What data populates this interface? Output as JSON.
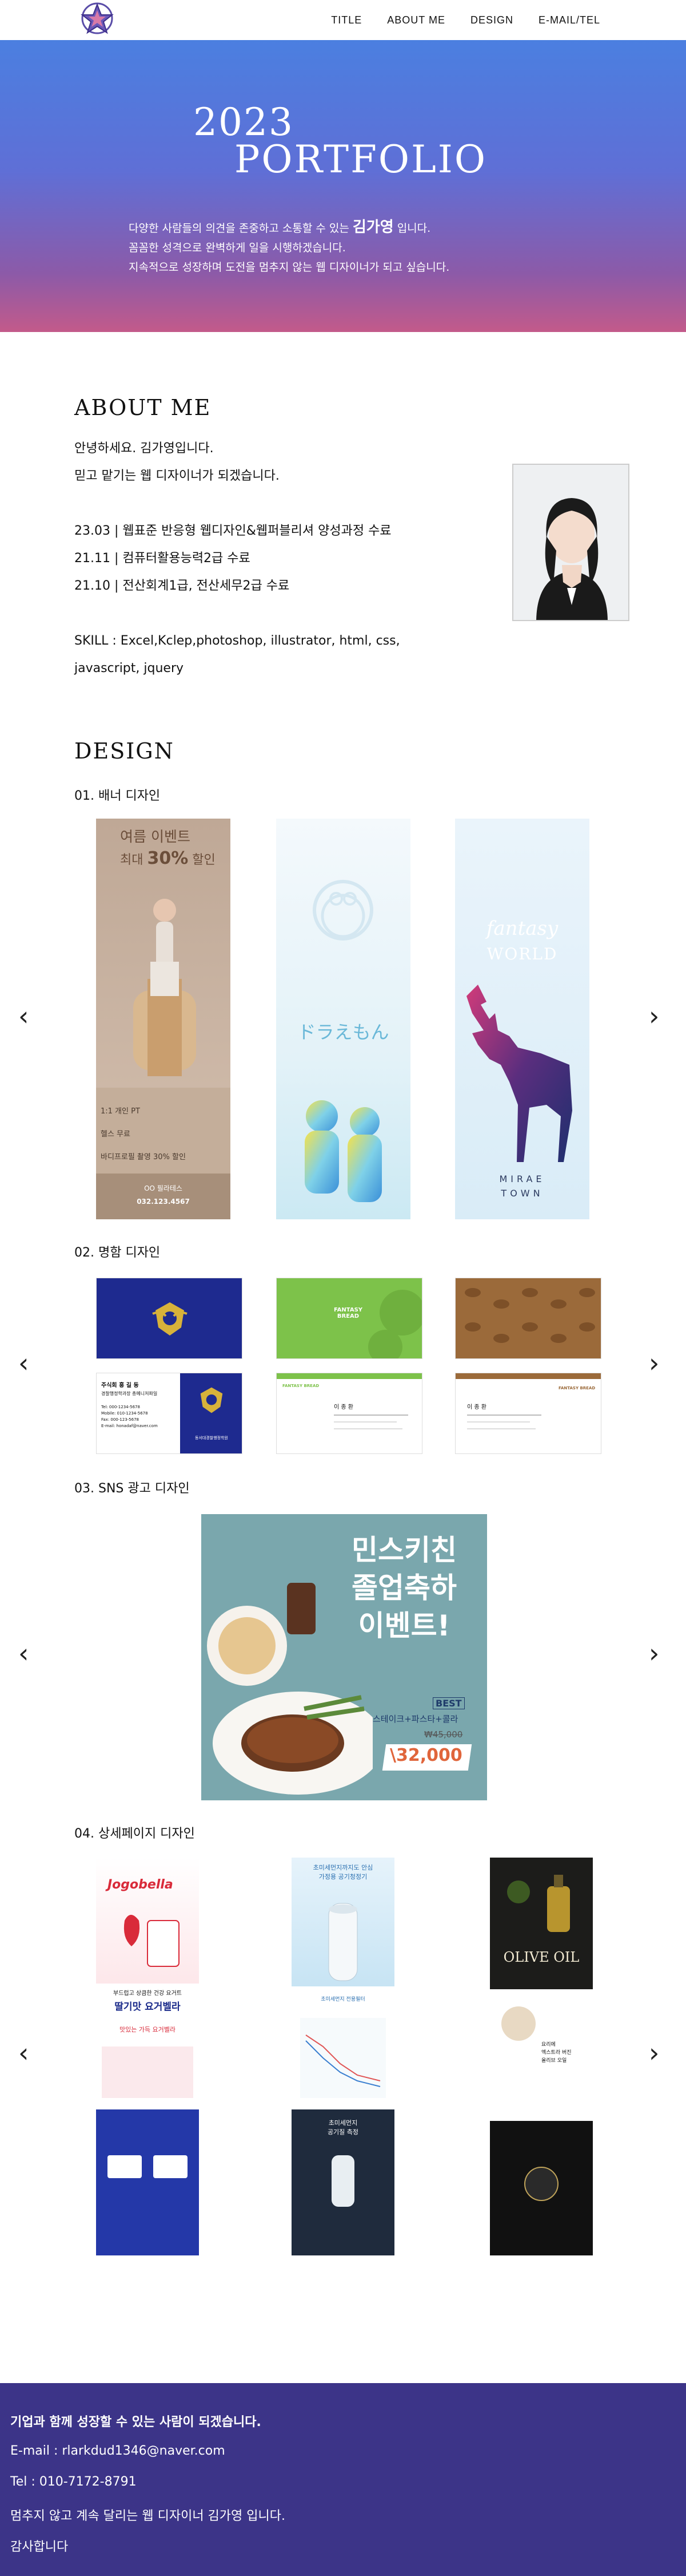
{
  "nav": {
    "links": [
      "TITLE",
      "ABOUT ME",
      "DESIGN",
      "E-MAIL/TEL"
    ]
  },
  "hero": {
    "year": "2023",
    "title": "PORTFOLIO",
    "line1_pre": "다양한 사람들의 의견을 존중하고 소통할 수 있는",
    "line1_name": "김가영",
    "line1_post": "입니다.",
    "line2": "꼼꼼한 성격으로 완벽하게 일을 시행하겠습니다.",
    "line3": "지속적으로 성장하며 도전을 멈추지 않는 웹 디자이너가 되고 싶습니다."
  },
  "about": {
    "heading": "ABOUT ME",
    "greeting1": "안녕하세요. 김가영입니다.",
    "greeting2": "믿고 맡기는 웹 디자이너가 되겠습니다.",
    "history": [
      "23.03 | 웹표준 반응형 웹디자인&웹퍼블리셔 양성과정 수료",
      "21.11 | 컴퓨터활용능력2급 수료",
      "21.10 | 전산회계1급, 전산세무2급 수료"
    ],
    "skill1": "SKILL : Excel,Kclep,photoshop, illustrator, html, css,",
    "skill2": "javascript, jquery"
  },
  "design": {
    "heading": "DESIGN",
    "sections": [
      "01. 배너 디자인",
      "02. 명함 디자인",
      "03. SNS 광고 디자인",
      "04. 상세페이지 디자인"
    ],
    "arrow_prev": "‹",
    "arrow_next": "›"
  },
  "banners": {
    "b1": {
      "title": "여름 이벤트",
      "sub_pre": "최대",
      "sub_pct": "30%",
      "sub_post": "할인",
      "line1": "1:1 개인 PT",
      "line2": "헬스 무료",
      "line3": "바디프로필 촬영 30% 할인",
      "brand": "OO 필라테스",
      "phone": "032.123.4567"
    },
    "b2": {
      "title": "ドラえもん"
    },
    "b3": {
      "title1": "fantasy",
      "title2": "WORLD",
      "bottom1": "MIRAE",
      "bottom2": "TOWN"
    }
  },
  "cards": {
    "c1_back_name": "주식회 홍 길 동",
    "c1_back_org": "경찰행정학과장 총메니저파일",
    "c1_back_lines": [
      "Tel: 000-1234-5678",
      "Mobile: 010-1234-5678",
      "Fax: 000-123-5678",
      "E-mail: honadaf@naver.com"
    ],
    "c1_back_label": "동서대경찰행정학원",
    "c2_brand1": "FANTASY",
    "c2_brand2": "BREAD",
    "c2_name": "이 종 환",
    "c3_brand1": "FANTASY",
    "c3_brand2": "BREAD",
    "c3_name": "이 종 환"
  },
  "sns": {
    "line1": "민스키친",
    "line2": "졸업축하",
    "line3": "이벤트!",
    "best": "BEST",
    "menu": "스테이크+파스타+콜라",
    "old_price": "₩45,000",
    "new_price": "\\32,000"
  },
  "details": {
    "d1_brand": "Jogobella",
    "d1_tag1": "부드럽고 상큼한 건강 요거트",
    "d1_title": "딸기맛 요거벨라",
    "d1_sub": "맛있는 가득 요거벨라",
    "d2_title1": "초미세먼지까지도 안심",
    "d2_title2": "가정용 공기청정기",
    "d2_mid": "초미세먼지 전용필터",
    "d2_bottom1": "초미세먼지",
    "d2_bottom2": "공기질 측정",
    "d3_title": "OLIVE OIL",
    "d3_mid1": "요리에",
    "d3_mid2": "엑스트라 버진",
    "d3_mid3": "올리브 오일"
  },
  "footer": {
    "l1": "기업과 함께 성장할 수 있는 사람이 되겠습니다.",
    "l2": "E-mail : rlarkdud1346@naver.com",
    "l3": "Tel : 010-7172-8791",
    "l4": "멈추지 않고 계속 달리는 웹 디자이너 김가영 입니다.",
    "l5": "감사합니다"
  }
}
